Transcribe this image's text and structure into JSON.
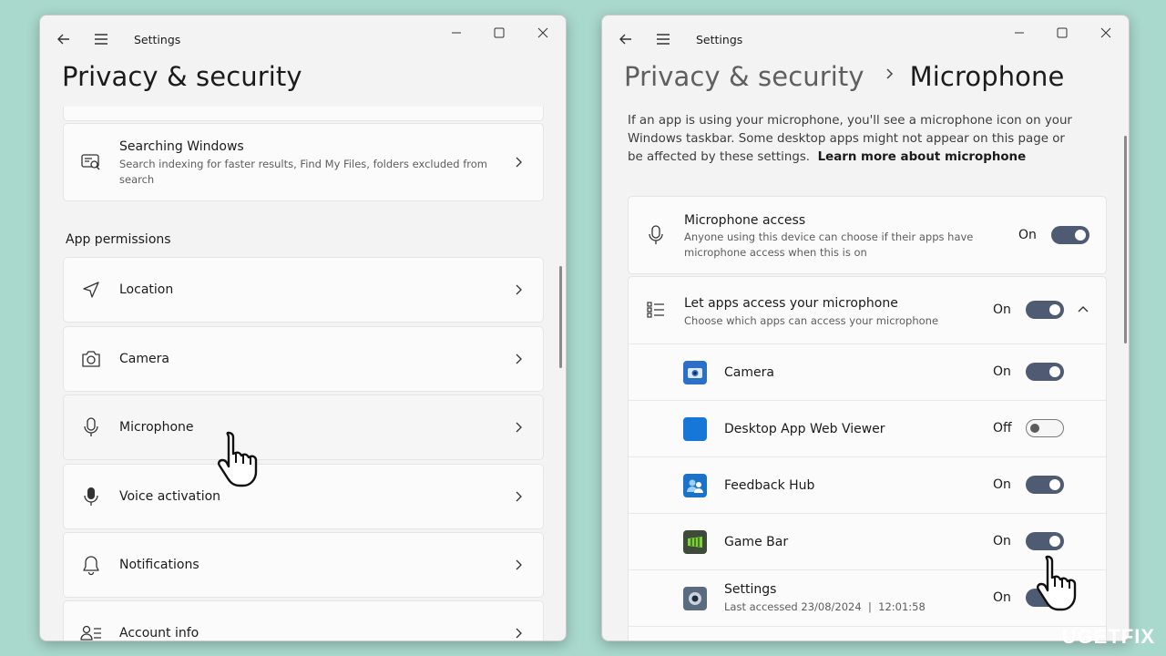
{
  "left_window": {
    "title": "Settings",
    "page_title": "Privacy & security",
    "searching": {
      "title": "Searching Windows",
      "subtitle": "Search indexing for faster results, Find My Files, folders excluded from search"
    },
    "section_label": "App permissions",
    "items": [
      {
        "label": "Location",
        "icon": "location-icon"
      },
      {
        "label": "Camera",
        "icon": "camera-icon"
      },
      {
        "label": "Microphone",
        "icon": "microphone-icon"
      },
      {
        "label": "Voice activation",
        "icon": "voice-activation-icon"
      },
      {
        "label": "Notifications",
        "icon": "bell-icon"
      },
      {
        "label": "Account info",
        "icon": "account-info-icon"
      }
    ]
  },
  "right_window": {
    "title": "Settings",
    "breadcrumb_parent": "Privacy & security",
    "breadcrumb_current": "Microphone",
    "description": "If an app is using your microphone, you'll see a microphone icon on your Windows taskbar. Some desktop apps might not appear on this page or be affected by these settings.",
    "learn_more": "Learn more about microphone",
    "mic_access": {
      "title": "Microphone access",
      "subtitle": "Anyone using this device can choose if their apps have microphone access when this is on",
      "state": "On"
    },
    "let_apps": {
      "title": "Let apps access your microphone",
      "subtitle": "Choose which apps can access your microphone",
      "state": "On"
    },
    "apps": [
      {
        "name": "Camera",
        "state": "On",
        "icon": "camera-app-icon",
        "color": "#2b6fc7"
      },
      {
        "name": "Desktop App Web Viewer",
        "state": "Off",
        "icon": "web-viewer-app-icon",
        "color": "#1677d8"
      },
      {
        "name": "Feedback Hub",
        "state": "On",
        "icon": "feedback-hub-app-icon",
        "color": "#1a73c9"
      },
      {
        "name": "Game Bar",
        "state": "On",
        "icon": "game-bar-app-icon",
        "color": "#5aa832"
      },
      {
        "name": "Settings",
        "state": "On",
        "icon": "settings-app-icon",
        "color": "#5a6b80",
        "subtitle": "Last accessed 23/08/2024  |  12:01:58"
      }
    ]
  },
  "watermark": "UGETFIX",
  "colors": {
    "background": "#a9d8cd",
    "toggle_on": "#4f5b72",
    "window": "#f3f3f3",
    "card": "#fbfbfb"
  }
}
